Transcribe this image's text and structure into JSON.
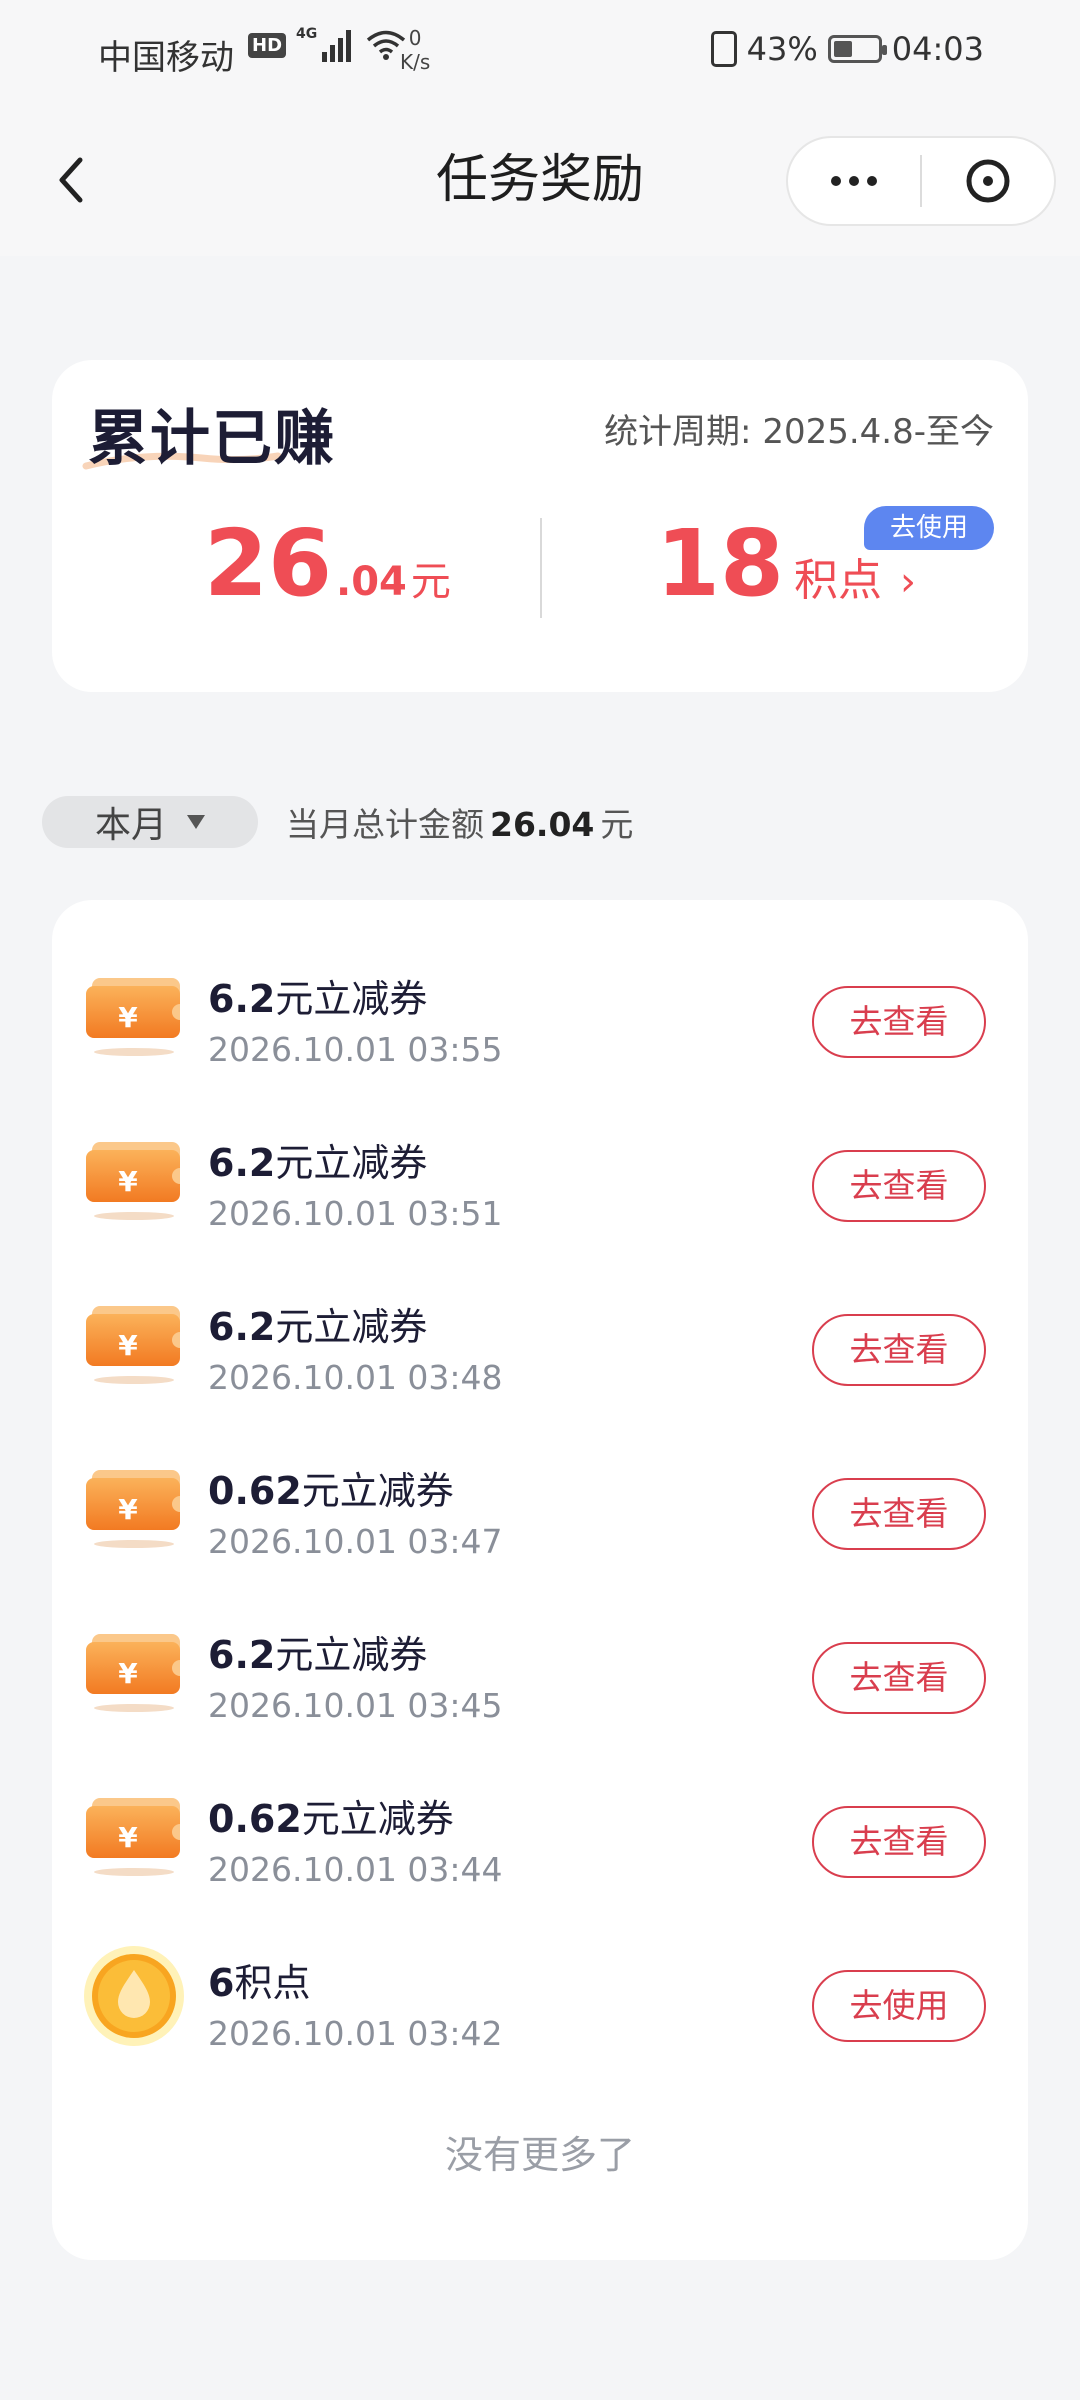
{
  "status_bar": {
    "carrier": "中国移动",
    "hd_badge": "HD",
    "network": "4G",
    "speed_value": "0",
    "speed_unit": "K/s",
    "battery": "43%",
    "battery_level": 0.43,
    "time": "04:03"
  },
  "nav": {
    "title": "任务奖励",
    "back_icon": "chevron-left-icon",
    "more_icon": "more-dots-icon",
    "close_icon": "close-circle-icon"
  },
  "summary": {
    "title": "累计已赚",
    "period": "统计周期: 2025.4.8-至今",
    "amount_int": "26",
    "amount_dec": ".04",
    "amount_unit": "元",
    "points_value": "18",
    "points_unit": "积点",
    "points_arrow": "›",
    "use_badge": "去使用"
  },
  "filter": {
    "month_label": "本月",
    "total_prefix": "当月总计金额",
    "total_value": "26.04",
    "total_unit": "元"
  },
  "rewards": [
    {
      "amount": "6.2",
      "label": "元立减券",
      "time": "2026.10.01 03:55",
      "action": "去查看",
      "icon": "coupon-icon"
    },
    {
      "amount": "6.2",
      "label": "元立减券",
      "time": "2026.10.01 03:51",
      "action": "去查看",
      "icon": "coupon-icon"
    },
    {
      "amount": "6.2",
      "label": "元立减券",
      "time": "2026.10.01 03:48",
      "action": "去查看",
      "icon": "coupon-icon"
    },
    {
      "amount": "0.62",
      "label": "元立减券",
      "time": "2026.10.01 03:47",
      "action": "去查看",
      "icon": "coupon-icon"
    },
    {
      "amount": "6.2",
      "label": "元立减券",
      "time": "2026.10.01 03:45",
      "action": "去查看",
      "icon": "coupon-icon"
    },
    {
      "amount": "0.62",
      "label": "元立减券",
      "time": "2026.10.01 03:44",
      "action": "去查看",
      "icon": "coupon-icon"
    },
    {
      "amount": "6",
      "label": "积点",
      "time": "2026.10.01 03:42",
      "action": "去使用",
      "icon": "points-coin-icon"
    }
  ],
  "footer": {
    "no_more": "没有更多了"
  },
  "colors": {
    "accent_red": "#ef4d55",
    "button_red": "#d93e4e",
    "badge_blue": "#5d86f0",
    "coupon_orange": "#f58a2e",
    "coin_yellow": "#fbd04a"
  }
}
